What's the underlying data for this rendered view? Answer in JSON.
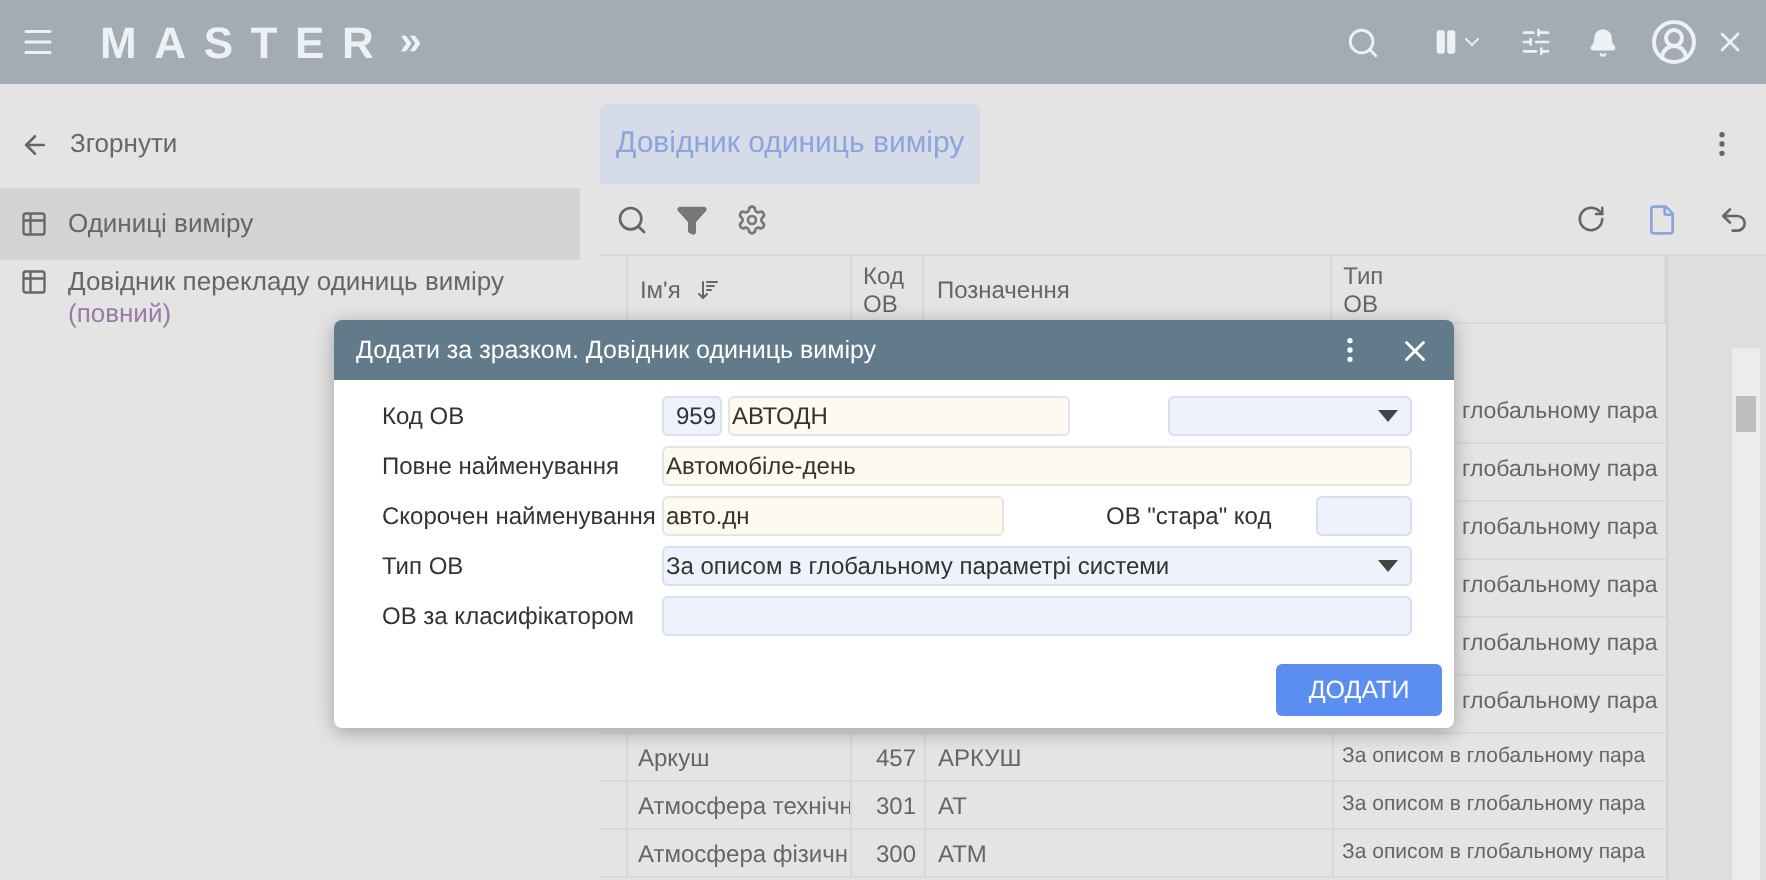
{
  "topbar": {
    "logo": "MASTER",
    "expand": "»"
  },
  "sidebar": {
    "collapse": "Згорнути",
    "items": [
      {
        "label": "Одиниці виміру",
        "selected": true
      },
      {
        "label": "Довідник перекладу одиниць виміру",
        "note": "(повний)",
        "selected": false
      }
    ]
  },
  "tab": {
    "label": "Довідник одиниць виміру",
    "selected": true
  },
  "table": {
    "columns": [
      "Ім'я",
      "Код ОВ",
      "Позначення",
      "Тип ОВ"
    ],
    "rows": [
      {
        "kind": "fragment",
        "type": "глобальному пара"
      },
      {
        "kind": "fragment",
        "type": "глобальному пара"
      },
      {
        "kind": "fragment",
        "type": "глобальному пара"
      },
      {
        "kind": "fragment",
        "type": "глобальному пара"
      },
      {
        "kind": "fragment",
        "type": "глобальному пара"
      },
      {
        "kind": "fragment",
        "type": "глобальному пара"
      },
      {
        "kind": "full",
        "name": "Аркуш",
        "code": "457",
        "symbol": "АРКУШ",
        "type": "За описом в глобальному пара"
      },
      {
        "kind": "full",
        "name": "Атмосфера технічн",
        "code": "301",
        "symbol": "АТ",
        "type": "За описом в глобальному пара"
      },
      {
        "kind": "full",
        "name": "Атмосфера фізичн",
        "code": "300",
        "symbol": "АТМ",
        "type": "За описом в глобальному пара"
      }
    ]
  },
  "dialog": {
    "title": "Додати за зразком. Довідник одиниць виміру",
    "code_label": "Код ОВ",
    "code_number": "959",
    "code_value": "АВТОДН",
    "full_name_label": "Повне найменування",
    "full_name": "Автомобіле-день",
    "short_name_label": "Скорочен найменування",
    "short_name": "авто.дн",
    "old_code_label": "ОВ \"стара\" код",
    "type_label": "Тип ОВ",
    "type_value": "За описом в глобальному параметрі системи",
    "classifier_label": "ОВ за класифікатором",
    "submit": "ДОДАТИ"
  }
}
